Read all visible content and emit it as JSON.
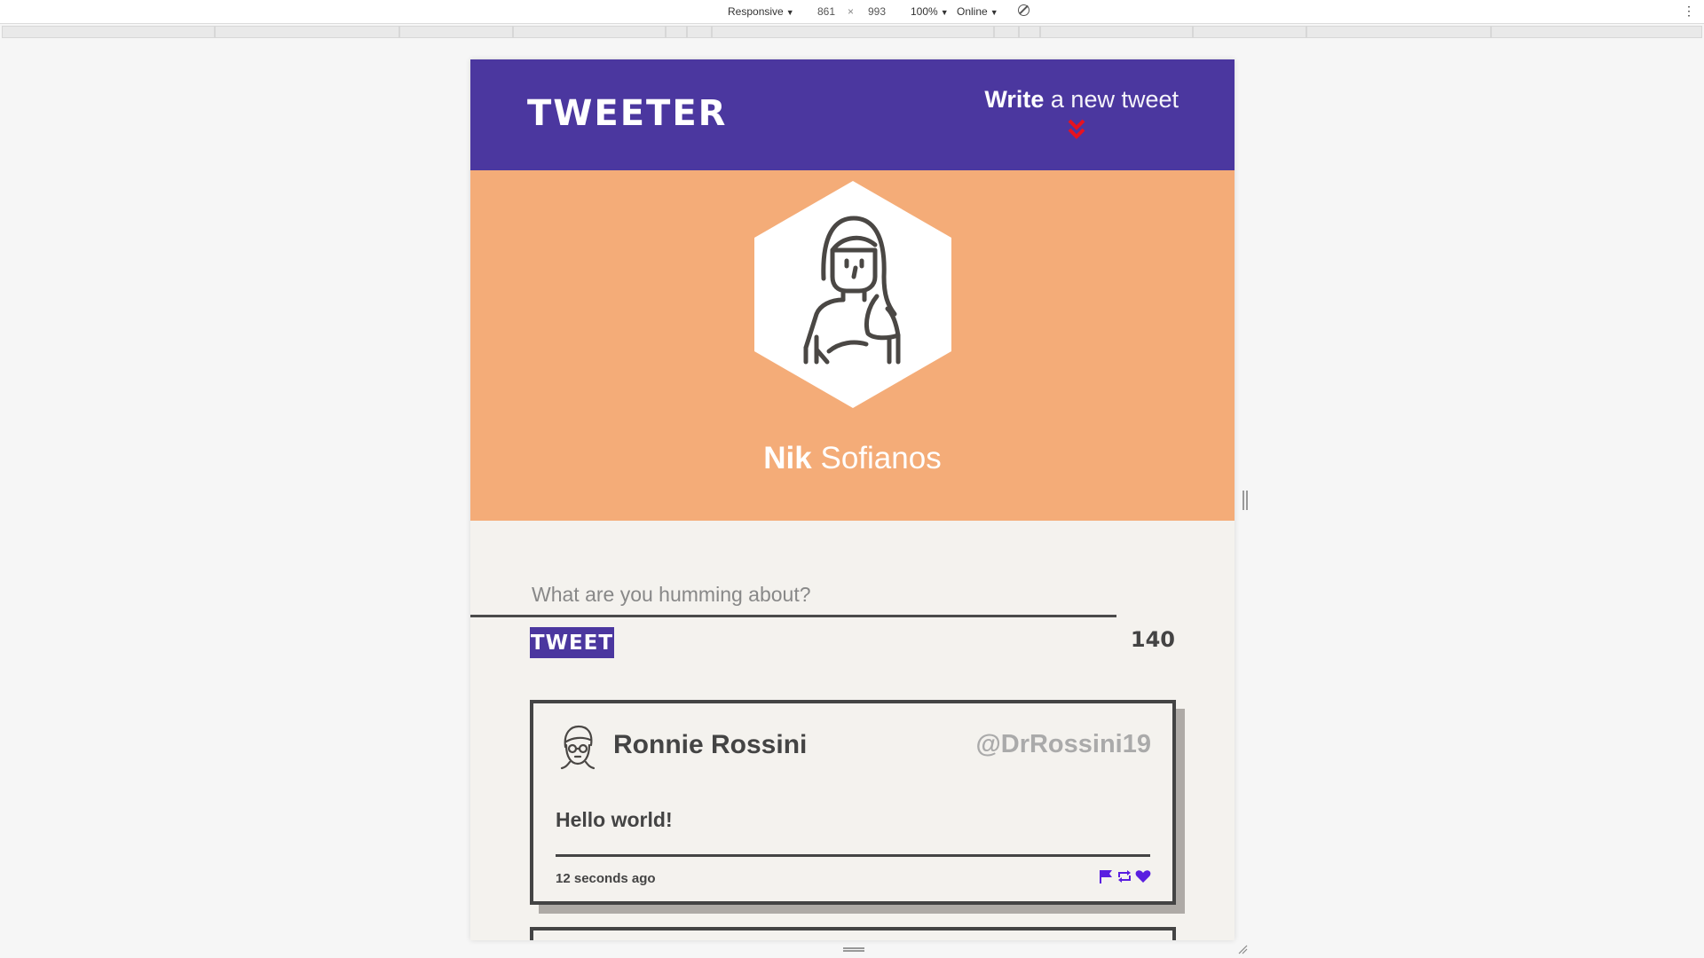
{
  "devtools": {
    "device_mode": "Responsive",
    "width_value": "861",
    "times": "×",
    "height_value": "993",
    "zoom": "100%",
    "network": "Online",
    "caret": "▼",
    "menu_glyph": "⋮"
  },
  "app": {
    "brand": "TWEETER",
    "compose_link_bold": "Write",
    "compose_link_rest": "a new tweet",
    "accent_color": "#4b379f",
    "profile_bg_color": "#f4ac78"
  },
  "profile": {
    "first_name": "Nik",
    "last_name": "Sofianos"
  },
  "composer": {
    "placeholder": "What are you humming about?",
    "button_label": "TWEET",
    "char_count": "140"
  },
  "tweets": [
    {
      "name": "Ronnie Rossini",
      "handle": "@DrRossini19",
      "text": "Hello world!",
      "time": "12 seconds ago"
    }
  ]
}
